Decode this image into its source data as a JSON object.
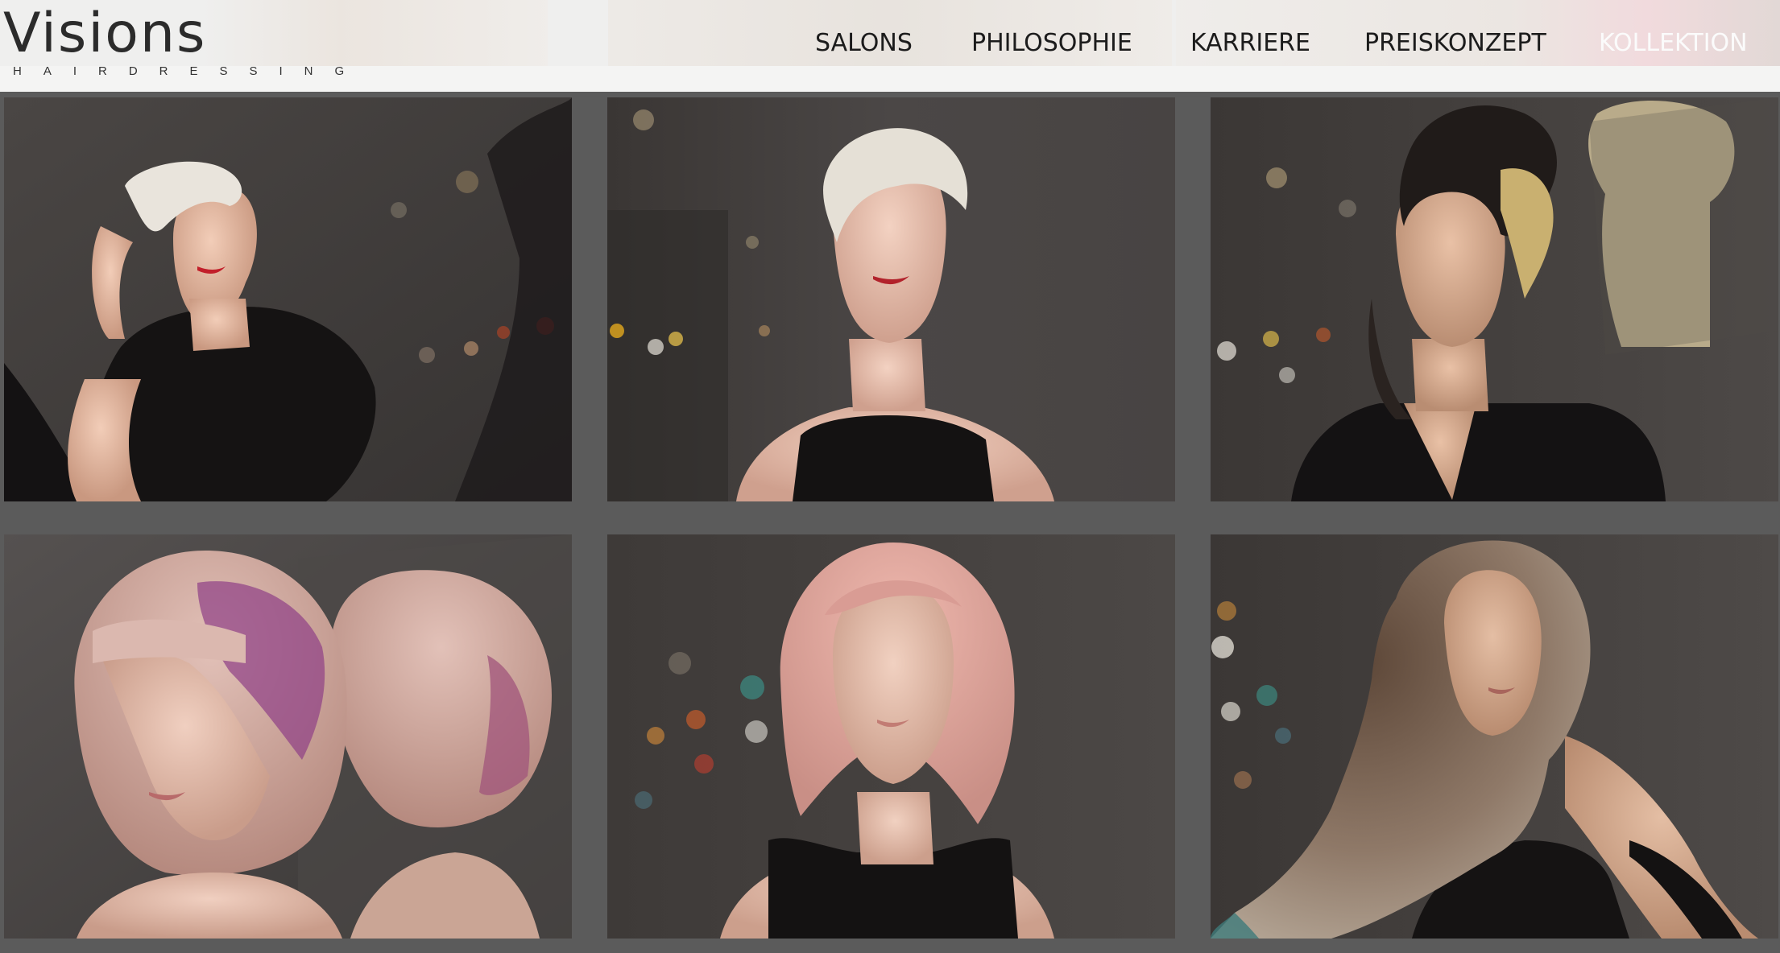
{
  "brand": {
    "logo_text": "Visions",
    "tagline": "HAIRDRESSING"
  },
  "nav": {
    "items": [
      {
        "label": "SALONS",
        "active": false
      },
      {
        "label": "PHILOSOPHIE",
        "active": false
      },
      {
        "label": "KARRIERE",
        "active": false
      },
      {
        "label": "PREISKONZEPT",
        "active": false
      },
      {
        "label": "KOLLEKTION",
        "active": true
      }
    ]
  },
  "colors": {
    "page_background": "#5b5b5b",
    "header_background": "#efefee",
    "nav_text": "#1c1c1c",
    "nav_active_text": "#fbfbfb"
  },
  "gallery": {
    "photos": [
      {
        "hair": "platinum pixie",
        "hair_color": "#e6e1d8",
        "top": "black sleeveless"
      },
      {
        "hair": "platinum pixie",
        "hair_color": "#e2ddd5",
        "top": "black sheer"
      },
      {
        "hair": "dark undercut with blonde",
        "hair_color": "#2a2420",
        "top": "black blazer"
      },
      {
        "hair": "pink and purple bob",
        "hair_color": "#c9a19a",
        "top": "none"
      },
      {
        "hair": "pink lob",
        "hair_color": "#d9a39b",
        "top": "black tank"
      },
      {
        "hair": "long ombre curls",
        "hair_color": "#7c6757",
        "top": "black long sleeve"
      }
    ]
  }
}
